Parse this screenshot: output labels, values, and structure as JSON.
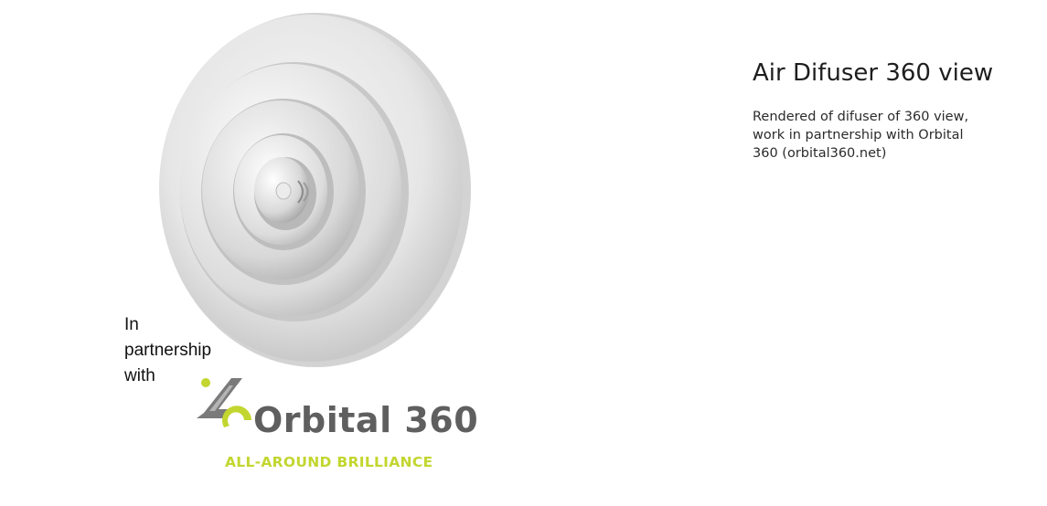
{
  "media": {
    "image_subject": "air-diffuser-render"
  },
  "partnership": {
    "caption": "In\npartnership\nwith",
    "logo": {
      "name": "Orbital 360",
      "tagline": "ALL-AROUND BRILLIANCE",
      "colors": {
        "brand_grey": "#5f5f5f",
        "brand_lime": "#c2d62f"
      }
    }
  },
  "project": {
    "title": "Air Difuser 360 view",
    "description": "Rendered of difuser of 360 view, work in partnership with Orbital 360 (orbital360.net)"
  },
  "colors": {
    "background": "#ffffff",
    "title_text": "#1e1e1e",
    "body_text": "#2b2b2b"
  }
}
